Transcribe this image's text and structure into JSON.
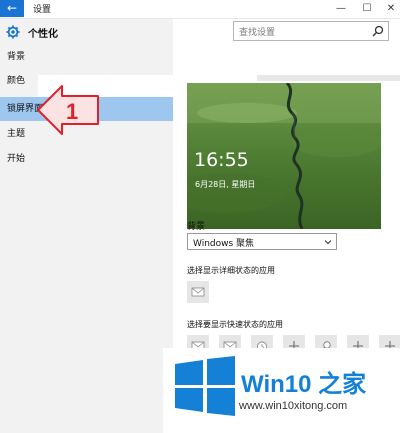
{
  "window": {
    "back_label": "←",
    "title": "设置",
    "minimize": "—",
    "maximize": "☐",
    "close": "✕"
  },
  "left_pane": {
    "title": "个性化",
    "items": [
      {
        "label": "背景",
        "selected": false
      },
      {
        "label": "颜色",
        "selected": false
      },
      {
        "label": "锁屏界面",
        "selected": true
      },
      {
        "label": "主题",
        "selected": false
      },
      {
        "label": "开始",
        "selected": false
      }
    ],
    "annotation_number": "1"
  },
  "search": {
    "placeholder": "查找设置"
  },
  "lockscreen": {
    "time": "16:55",
    "date": "6月28日, 星期日",
    "background_label": "背景",
    "background_value": "Windows 聚焦",
    "detail_status_label": "选择显示详细状态的应用",
    "quick_status_label": "选择要显示快速状态的应用",
    "quick_tiles": [
      "mail-icon",
      "mail-icon",
      "alarm-icon",
      "plus-icon",
      "search-icon",
      "plus-icon",
      "plus-icon"
    ]
  },
  "watermark": {
    "brand": "Win10 之家",
    "url": "www.win10xitong.com",
    "accent": "#1480d6"
  },
  "colors": {
    "accent": "#1a74d4",
    "selection": "#9dc7ef",
    "annotation": "#e0212b"
  }
}
